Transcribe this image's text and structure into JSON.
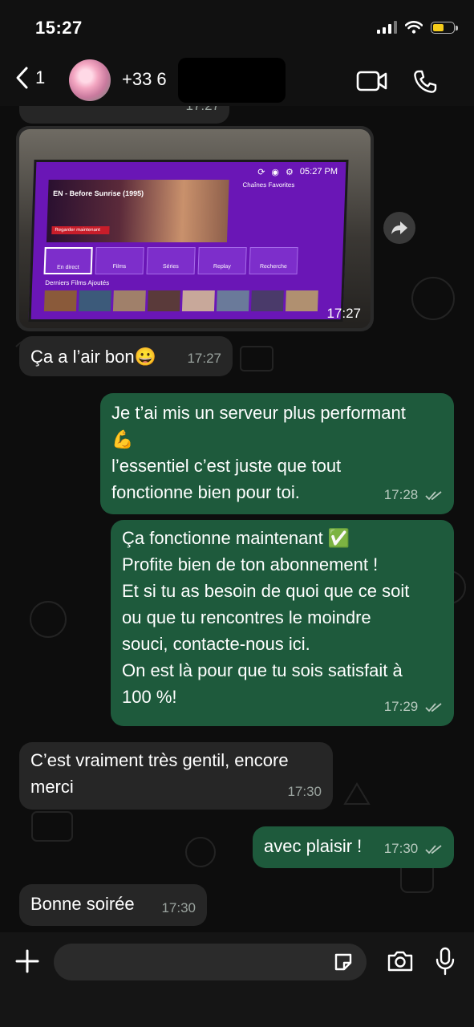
{
  "status_bar": {
    "time": "15:27"
  },
  "header": {
    "back_count": "1",
    "contact_name": "+33 6 "
  },
  "messages": [
    {
      "id": "m0",
      "dir": "in",
      "text": "",
      "time": "17:27"
    },
    {
      "id": "m1",
      "dir": "in",
      "type": "image",
      "time": "17:27",
      "image": {
        "tv_time": "05:27 PM",
        "hero_title": "EN - Before Sunrise (1995)",
        "hero_button": "Regarder maintenant",
        "favorites_label": "Chaînes Favorites",
        "tiles": [
          "En direct",
          "Films",
          "Séries",
          "Replay",
          "Recherche"
        ],
        "films_label": "Derniers Films Ajoutés"
      }
    },
    {
      "id": "m2",
      "dir": "in",
      "text": "Ça a l’air bon😀",
      "time": "17:27"
    },
    {
      "id": "m3",
      "dir": "out",
      "lines": [
        "Je t’ai mis un serveur plus performant",
        "💪",
        "l’essentiel c’est juste que tout",
        "fonctionne bien pour toi."
      ],
      "time": "17:28"
    },
    {
      "id": "m4",
      "dir": "out",
      "lines": [
        "Ça fonctionne maintenant ✅",
        "Profite bien de ton abonnement !",
        "Et si tu as besoin de quoi que ce soit",
        "ou que tu rencontres le moindre",
        "souci, contacte-nous ici.",
        "On est là pour que tu sois satisfait à",
        "100 %!"
      ],
      "time": "17:29"
    },
    {
      "id": "m5",
      "dir": "in",
      "lines": [
        "C’est vraiment très gentil, encore",
        "merci"
      ],
      "time": "17:30"
    },
    {
      "id": "m6",
      "dir": "out",
      "text": "avec plaisir !",
      "time": "17:30"
    },
    {
      "id": "m7",
      "dir": "in",
      "text": "Bonne soirée",
      "time": "17:30"
    }
  ],
  "colors": {
    "incoming": "#262626",
    "outgoing": "#1e5a3c",
    "background": "#0d0d0d"
  },
  "icons": [
    "chevron-left-icon",
    "video-call-icon",
    "phone-icon",
    "forward-icon",
    "plus-icon",
    "sticker-icon",
    "camera-icon",
    "microphone-icon",
    "double-check-icon"
  ]
}
